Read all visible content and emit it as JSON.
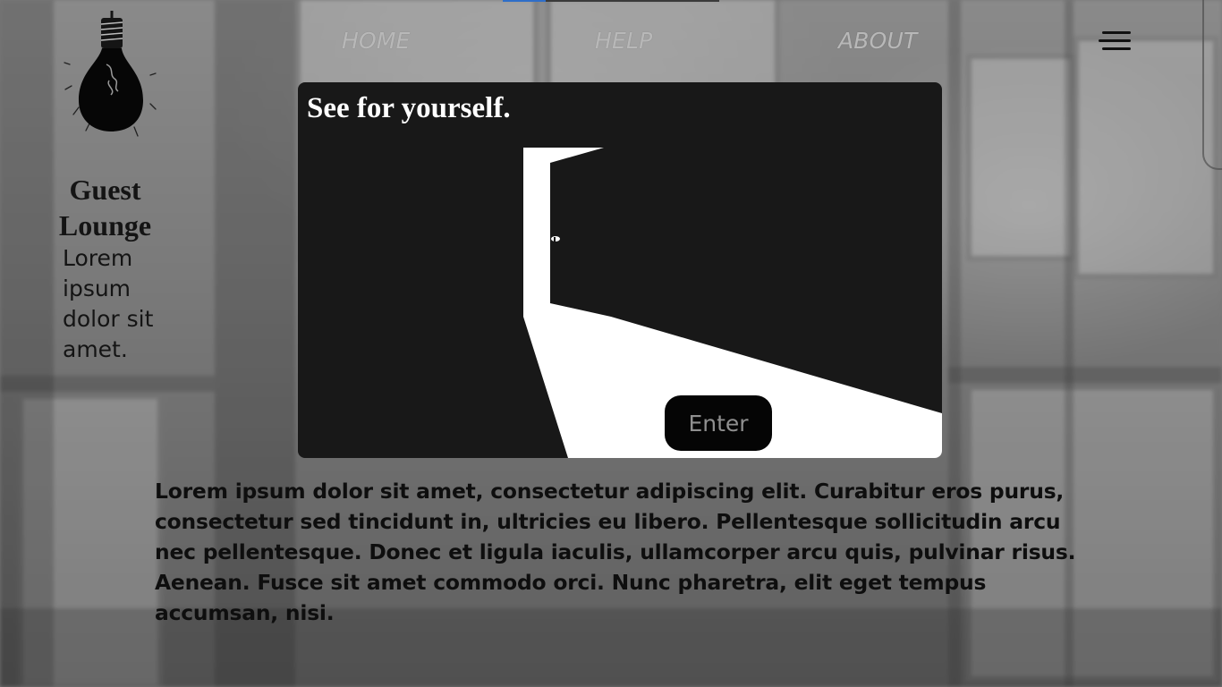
{
  "site": {
    "title": "Guest Lounge",
    "tagline": "Lorem ipsum dolor sit amet."
  },
  "nav": {
    "items": [
      {
        "label": "HOME"
      },
      {
        "label": "HELP"
      },
      {
        "label": "ABOUT"
      }
    ],
    "menu_icon": "hamburger-menu-icon"
  },
  "progress": {
    "fraction": 0.2
  },
  "hero": {
    "heading": "See for yourself.",
    "enter_label": "Enter"
  },
  "body": {
    "text": "Lorem ipsum dolor sit amet, consectetur adipiscing elit. Curabitur eros purus, consectetur sed tincidunt in, ultricies eu libero. Pellentesque sollicitudin arcu nec pellentesque. Donec et ligula iaculis, ullamcorper arcu quis, pulvinar risus. Aenean. Fusce sit amet commodo orci. Nunc pharetra, elit eget tempus accumsan, nisi."
  },
  "colors": {
    "card_background": "#181818",
    "nav_text": "#b8b8b8",
    "progress_accent": "#2f6ec8"
  }
}
